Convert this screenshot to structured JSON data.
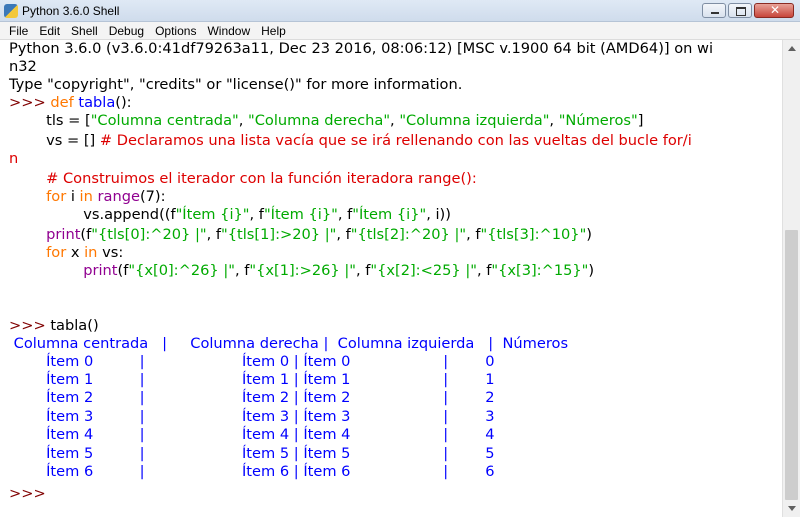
{
  "window": {
    "title": "Python 3.6.0 Shell"
  },
  "menu": [
    "File",
    "Edit",
    "Shell",
    "Debug",
    "Options",
    "Window",
    "Help"
  ],
  "banner": {
    "line1": "Python 3.6.0 (v3.6.0:41df79263a11, Dec 23 2016, 08:06:12) [MSC v.1900 64 bit (AMD64)] on wi",
    "line2": "n32",
    "line3": "Type \"copyright\", \"credits\" or \"license()\" for more information."
  },
  "code": {
    "prompt": ">>> ",
    "def_kw": "def",
    "func_name": "tabla",
    "def_rest": "():",
    "tls_indent": "        tls = [",
    "tls_s1": "\"Columna centrada\"",
    "tls_s2": "\"Columna derecha\"",
    "tls_s3": "\"Columna izquierda\"",
    "tls_s4": "\"Números\"",
    "tls_close": "]",
    "vs_indent": "        vs = [] ",
    "comment1a": "# Declaramos una lista vacía que se irá rellenando con las vueltas del bucle for/i",
    "comment1b": "n",
    "comment2": "        # Construimos el iterador con la función iteradora range():",
    "for1_kw": "for",
    "for1_var": " i ",
    "for1_in": "in",
    "for1_range": "range",
    "for1_rest": "(7):",
    "append_pre": "                vs.append((f",
    "append_s1": "\"Ítem {i}\"",
    "append_s2": "\"Ítem {i}\"",
    "append_s3": "\"Ítem {i}\"",
    "append_post": ", i))",
    "print1_kw": "print",
    "print1_pre": "(f",
    "print1_s1": "\"{tls[0]:^20} |\"",
    "print1_s2": "\"{tls[1]:>20} |\"",
    "print1_s3": "\"{tls[2]:^20} |\"",
    "print1_s4": "\"{tls[3]:^10}\"",
    "for2_kw": "for",
    "for2_var": " x ",
    "for2_in": "in",
    "for2_rest": " vs:",
    "print2_kw": "print",
    "print2_pre": "(f",
    "print2_s1": "\"{x[0]:^26} |\"",
    "print2_s2": "\"{x[1]:>26} |\"",
    "print2_s3": "\"{x[2]:<25} |\"",
    "print2_s4": "\"{x[3]:^15}\"",
    "close_paren": ")",
    "comma_f": ", f",
    "call": "tabla()"
  },
  "output": {
    "header": " Columna centrada   |     Columna derecha |  Columna izquierda   |  Números",
    "rows": [
      "        Ítem 0          |                     Ítem 0 | Ítem 0                    |        0",
      "        Ítem 1          |                     Ítem 1 | Ítem 1                    |        1",
      "        Ítem 2          |                     Ítem 2 | Ítem 2                    |        2",
      "        Ítem 3          |                     Ítem 3 | Ítem 3                    |        3",
      "        Ítem 4          |                     Ítem 4 | Ítem 4                    |        4",
      "        Ítem 5          |                     Ítem 5 | Ítem 5                    |        5",
      "        Ítem 6          |                     Ítem 6 | Ítem 6                    |        6"
    ]
  },
  "final_prompt": ">>>"
}
